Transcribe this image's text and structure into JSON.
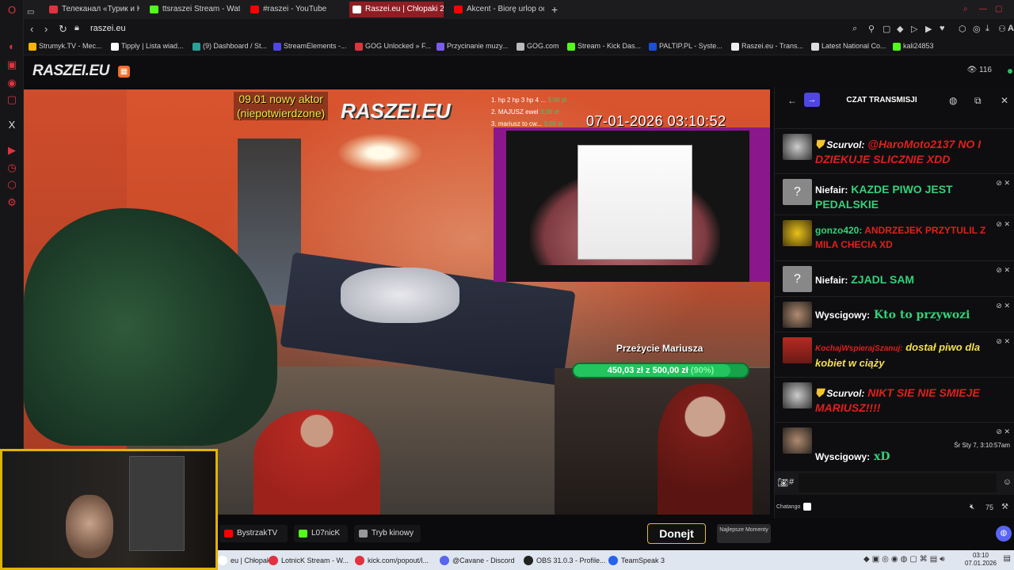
{
  "browser": {
    "tabs": [
      {
        "label": "Телеканал «Турик и Конь»",
        "color": "#e0323f"
      },
      {
        "label": "ttsraszei Stream - Watch Live",
        "color": "#53fc18"
      },
      {
        "label": "#raszei - YouTube",
        "color": "#ff0000"
      },
      {
        "label": "Raszei.eu | Chłopaki 2",
        "color": "#ffffff"
      },
      {
        "label": "Akcent - Biorę urlop od Ciebie",
        "color": "#ff0000"
      }
    ],
    "new_tab": "+",
    "url": "raszei.eu",
    "bookmarks": [
      {
        "label": "Strumyk.TV - Mec...",
        "color": "#f5b400"
      },
      {
        "label": "Tipply | Lista wiad...",
        "color": "#ffffff"
      },
      {
        "label": "(9) Dashboard / St...",
        "color": "#2aa198"
      },
      {
        "label": "StreamElements -...",
        "color": "#4f46e5"
      },
      {
        "label": "GOG Unlocked » F...",
        "color": "#e0323f"
      },
      {
        "label": "Przycinanie muzy...",
        "color": "#7c5cf6"
      },
      {
        "label": "GOG.com",
        "color": "#bbbbbb"
      },
      {
        "label": "Stream - Kick Das...",
        "color": "#53fc18"
      },
      {
        "label": "PALTIP.PL - Syste...",
        "color": "#1d4ed8"
      },
      {
        "label": "Raszei.eu - Trans...",
        "color": "#eeeeee"
      },
      {
        "label": "Latest National Co...",
        "color": "#dddddd"
      },
      {
        "label": "kali24853",
        "color": "#53fc18"
      }
    ]
  },
  "site": {
    "logo": "RASZEI.EU",
    "viewer_count": "116"
  },
  "stream": {
    "overlay_actor": "09.01 nowy aktor\n(niepotwierdzone)",
    "overlay_logo": "RASZEI.EU",
    "top_donors": [
      {
        "rank": "1. hp 2 hp 3 hp 4 ...",
        "amount": "3,00 zł"
      },
      {
        "rank": "2. MAJUSZ ewel",
        "amount": "3,00 zł"
      },
      {
        "rank": "3. mariusz to cw...",
        "amount": "3,00 zł"
      }
    ],
    "timestamp": "07-01-2026 03:10:52",
    "goal_title": "Przeżycie Mariusza",
    "goal_amount": "450,03 zł z 500,00 zł",
    "goal_percent_text": "(90%)",
    "goal_fraction": 0.9
  },
  "video_bar": {
    "btn1": "BystrzakTV",
    "btn2": "L07nicK",
    "btn3": "Tryb kinowy",
    "donate": "Donejt",
    "najlepsze": "Najlepsze Momenty"
  },
  "chat": {
    "title": "CZAT TRANSMISJI",
    "messages": [
      {
        "user": "Scurvol:",
        "text": "@HaroMoto2137 NO I DZIEKUJE SLICZNIE XDD"
      },
      {
        "user": "Niefair:",
        "text": "KAZDE PIWO JEST PEDALSKIE"
      },
      {
        "user": "gonzo420:",
        "text": "ANDRZEJEK PRZYTULIL Z MILA CHECIA XD"
      },
      {
        "user": "Niefair:",
        "text": "ZJADL SAM"
      },
      {
        "user": "Wyscigowy:",
        "text": "Kto to przywozi"
      },
      {
        "user": "KochajWspierajSzanuj:",
        "text": "dostał piwo dla kobiet w ciąży"
      },
      {
        "user": "Scurvol:",
        "text": "NIKT SIE NIE SMIEJE MARIUSZ!!!!"
      },
      {
        "user": "Wyscigowy:",
        "text": "xD",
        "time": "Śr Sty 7, 3:10:57am"
      }
    ],
    "input_prefix": "#",
    "footer_label": "Chatango",
    "volume": "75"
  },
  "taskbar": {
    "items": [
      {
        "label": "eu | Chłopak...",
        "color": "#ffffff"
      },
      {
        "label": "LotnicK Stream - W...",
        "color": "#e0323f"
      },
      {
        "label": "kick.com/popout/l...",
        "color": "#e0323f"
      },
      {
        "label": "@Cavane - Discord",
        "color": "#5865f2"
      },
      {
        "label": "OBS 31.0.3 - Profile...",
        "color": "#222222"
      },
      {
        "label": "TeamSpeak 3",
        "color": "#2563eb"
      }
    ],
    "time": "03:10",
    "date": "07.01.2026"
  }
}
